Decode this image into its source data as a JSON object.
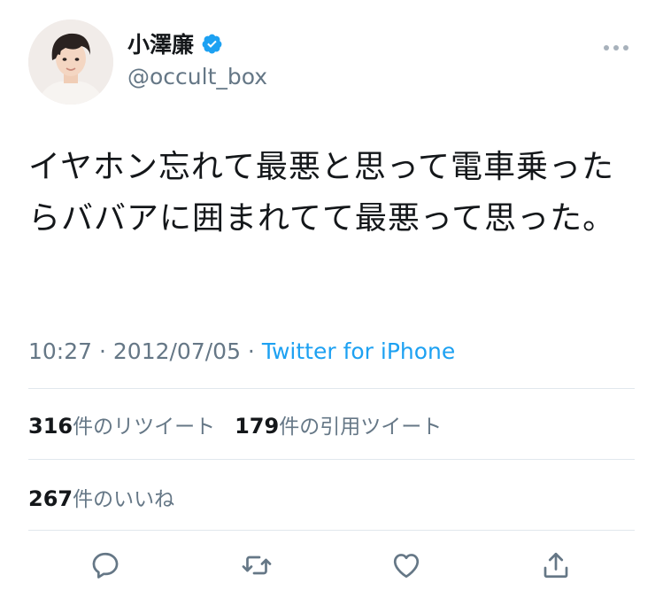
{
  "user": {
    "display_name": "小澤廉",
    "handle": "@occult_box",
    "verified": true
  },
  "tweet": {
    "text": "イヤホン忘れて最悪と思って電車乗ったらババアに囲まれてて最悪って思った。",
    "time": "10:27",
    "separator1": " · ",
    "date": "2012/07/05",
    "separator2": " · ",
    "source": "Twitter for iPhone"
  },
  "stats": {
    "retweets_count": "316",
    "retweets_label": "件のリツイート",
    "quotes_count": "179",
    "quotes_label": "件の引用ツイート",
    "likes_count": "267",
    "likes_label": "件のいいね"
  },
  "colors": {
    "accent": "#1da1f2",
    "secondary_text": "#657786",
    "icon": "#657786",
    "divider": "#e1e8ed"
  },
  "icons": {
    "more": "more-dots-icon",
    "reply": "reply-icon",
    "retweet": "retweet-icon",
    "like": "heart-icon",
    "share": "share-icon",
    "verified": "verified-badge-icon"
  }
}
